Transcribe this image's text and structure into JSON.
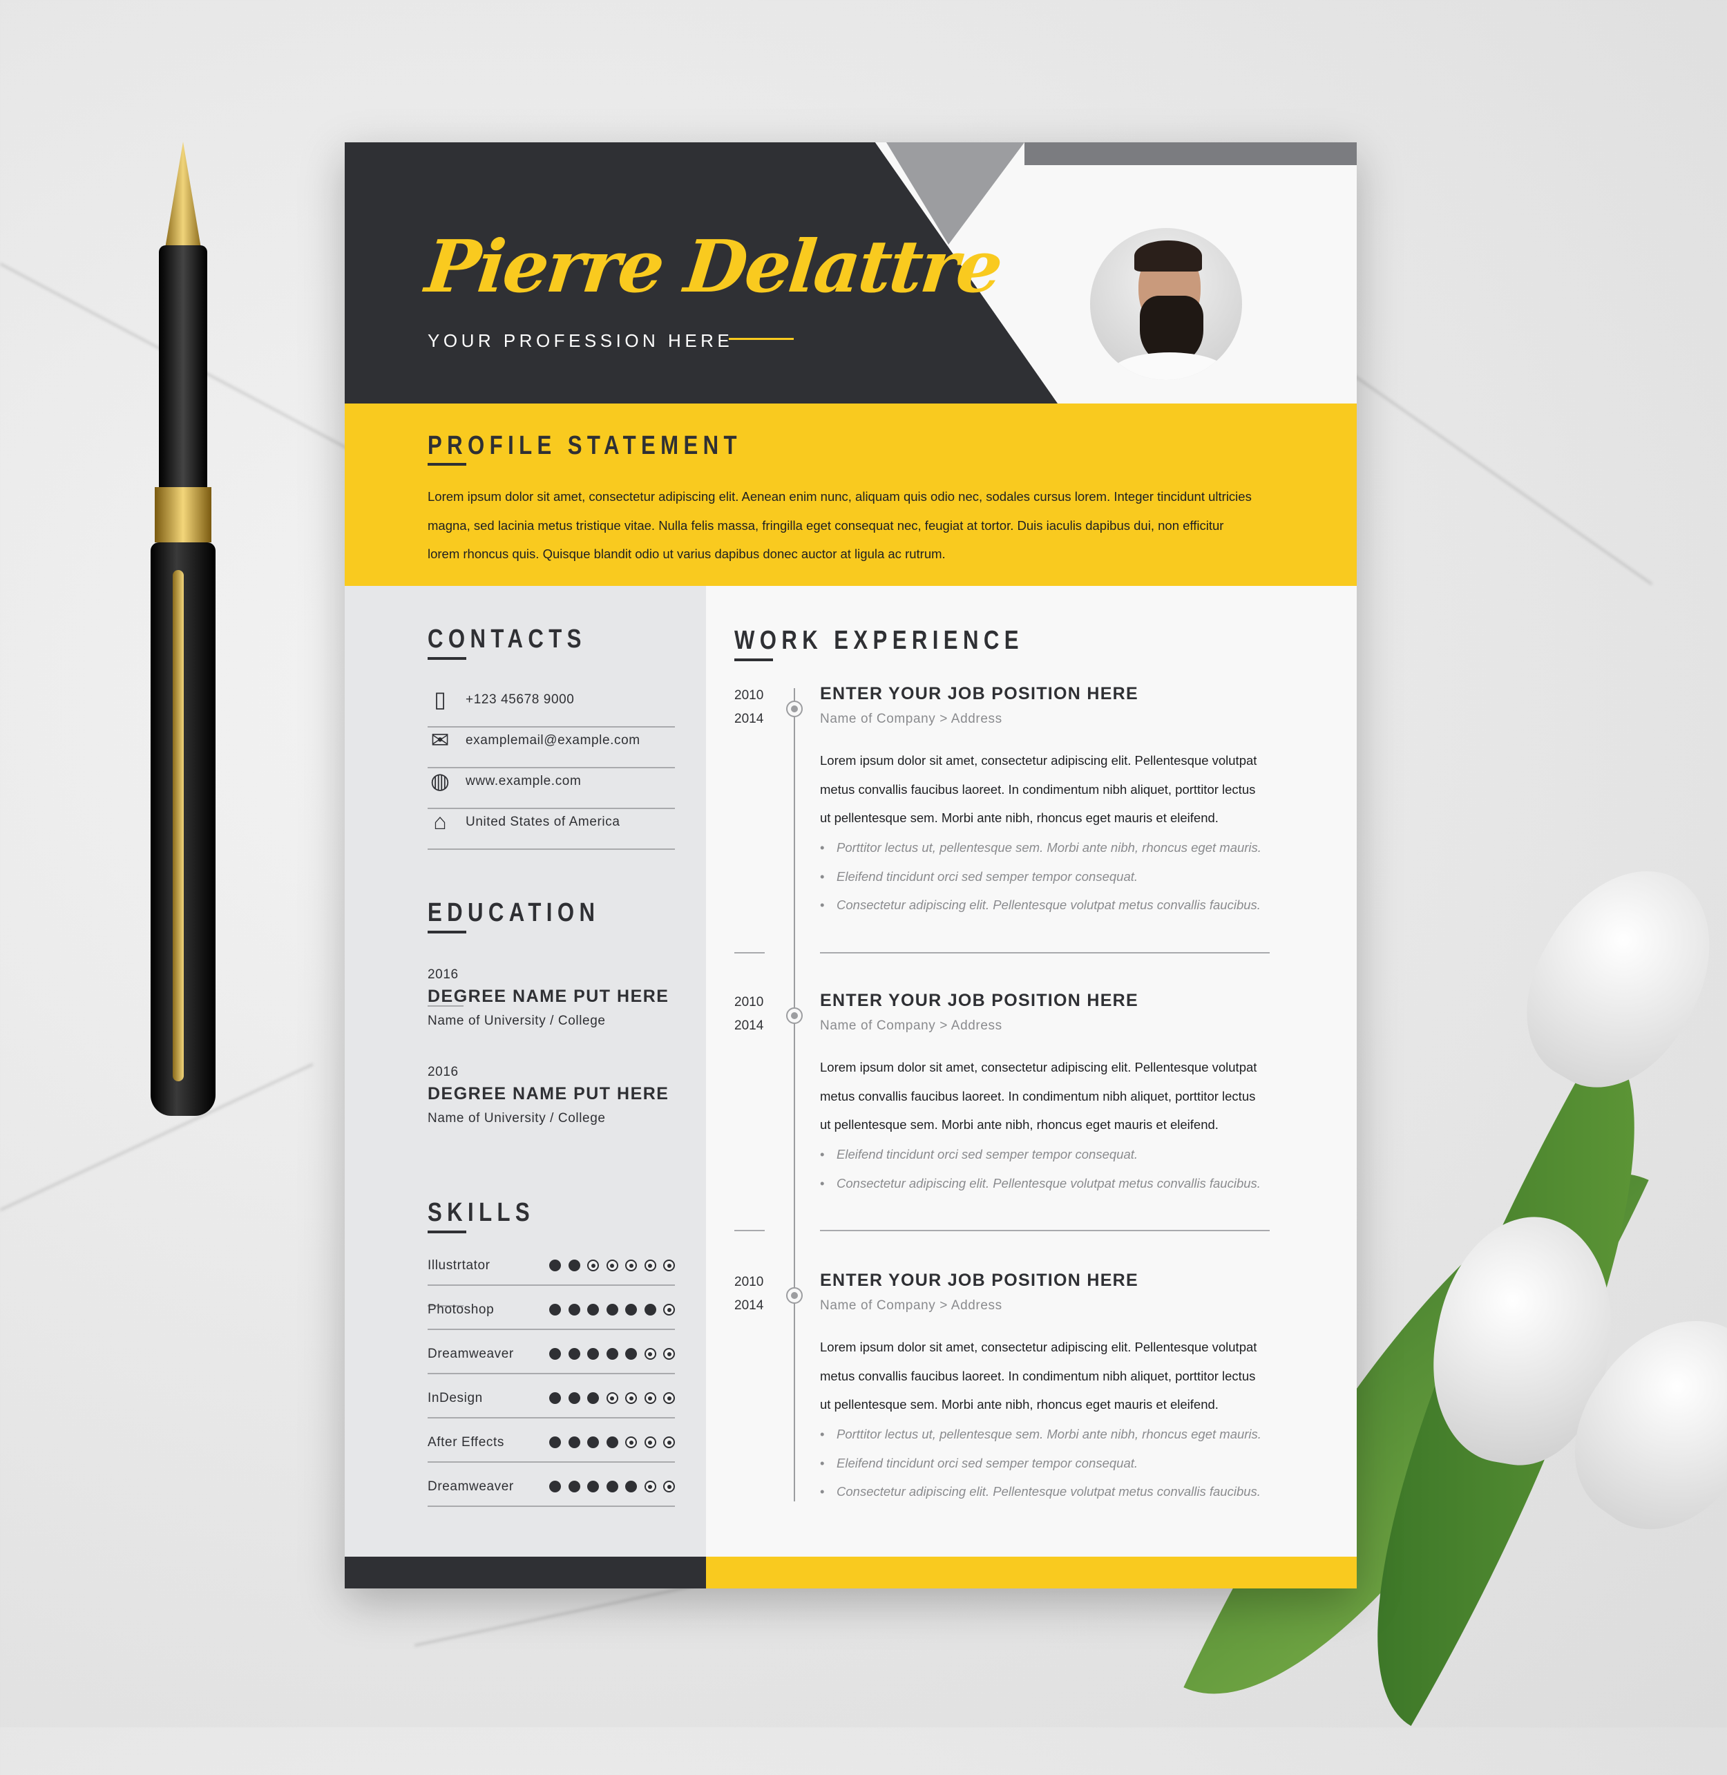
{
  "colors": {
    "accent": "#f9ca1f",
    "dark": "#2f3034",
    "gray": "#9c9da0",
    "panel": "#e6e7e9"
  },
  "header": {
    "name": "Pierre Delattre",
    "profession": "YOUR PROFESSION HERE"
  },
  "profile": {
    "heading": "PROFILE STATEMENT",
    "lines": [
      "Lorem ipsum dolor sit amet, consectetur adipiscing elit. Aenean enim nunc, aliquam quis odio nec, sodales cursus lorem. Integer tincidunt ultricies",
      "magna, sed lacinia metus tristique vitae. Nulla felis massa, fringilla eget consequat nec, feugiat at tortor. Duis iaculis dapibus dui, non efficitur",
      "lorem rhoncus quis. Quisque blandit odio ut varius dapibus donec auctor at ligula ac rutrum."
    ]
  },
  "contacts": {
    "heading": "CONTACTS",
    "items": [
      {
        "icon": "phone-icon",
        "text": "+123 45678 9000"
      },
      {
        "icon": "mail-icon",
        "text": "examplemail@example.com"
      },
      {
        "icon": "globe-icon",
        "text": "www.example.com"
      },
      {
        "icon": "home-icon",
        "text": "United States of America"
      }
    ]
  },
  "education": {
    "heading": "EDUCATION",
    "items": [
      {
        "year": "2016",
        "degree": "DEGREE NAME PUT HERE",
        "school": "Name of University / College"
      },
      {
        "year": "2016",
        "degree": "DEGREE NAME PUT HERE",
        "school": "Name of University / College"
      }
    ]
  },
  "skills": {
    "heading": "SKILLS",
    "max": 7,
    "items": [
      {
        "name": "Illustrtator",
        "level": 2
      },
      {
        "name": "Photoshop",
        "level": 6
      },
      {
        "name": "Dreamweaver",
        "level": 5
      },
      {
        "name": "InDesign",
        "level": 3
      },
      {
        "name": "After Effects",
        "level": 4
      },
      {
        "name": "Dreamweaver",
        "level": 5
      }
    ]
  },
  "work": {
    "heading": "WORK EXPERIENCE",
    "jobs": [
      {
        "start": "2010",
        "end": "2014",
        "title": "ENTER YOUR JOB POSITION HERE",
        "company": "Name of Company > Address",
        "desc": [
          "Lorem ipsum dolor sit amet, consectetur adipiscing elit. Pellentesque volutpat",
          "metus convallis faucibus laoreet. In condimentum nibh aliquet, porttitor lectus",
          "ut  pellentesque sem. Morbi ante nibh, rhoncus eget mauris et eleifend."
        ],
        "bullets": [
          "Porttitor lectus ut, pellentesque sem. Morbi ante nibh, rhoncus eget mauris.",
          "Eleifend tincidunt orci sed semper tempor consequat.",
          "Consectetur adipiscing elit. Pellentesque volutpat metus convallis faucibus."
        ]
      },
      {
        "start": "2010",
        "end": "2014",
        "title": "ENTER YOUR JOB POSITION HERE",
        "company": "Name of Company > Address",
        "desc": [
          "Lorem ipsum dolor sit amet, consectetur adipiscing elit. Pellentesque volutpat",
          "metus convallis faucibus laoreet. In condimentum nibh aliquet, porttitor lectus",
          "ut  pellentesque sem. Morbi ante nibh, rhoncus eget mauris et eleifend."
        ],
        "bullets": [
          "Eleifend tincidunt orci sed semper tempor consequat.",
          "Consectetur adipiscing elit. Pellentesque volutpat metus convallis faucibus."
        ]
      },
      {
        "start": "2010",
        "end": "2014",
        "title": "ENTER YOUR JOB POSITION HERE",
        "company": "Name of Company > Address",
        "desc": [
          "Lorem ipsum dolor sit amet, consectetur adipiscing elit. Pellentesque volutpat",
          "metus convallis faucibus laoreet. In condimentum nibh aliquet, porttitor lectus",
          "ut  pellentesque sem. Morbi ante nibh, rhoncus eget mauris et eleifend."
        ],
        "bullets": [
          "Porttitor lectus ut, pellentesque sem. Morbi ante nibh, rhoncus eget mauris.",
          "Eleifend tincidunt orci sed semper tempor consequat.",
          "Consectetur adipiscing elit. Pellentesque volutpat metus convallis faucibus."
        ]
      }
    ]
  }
}
